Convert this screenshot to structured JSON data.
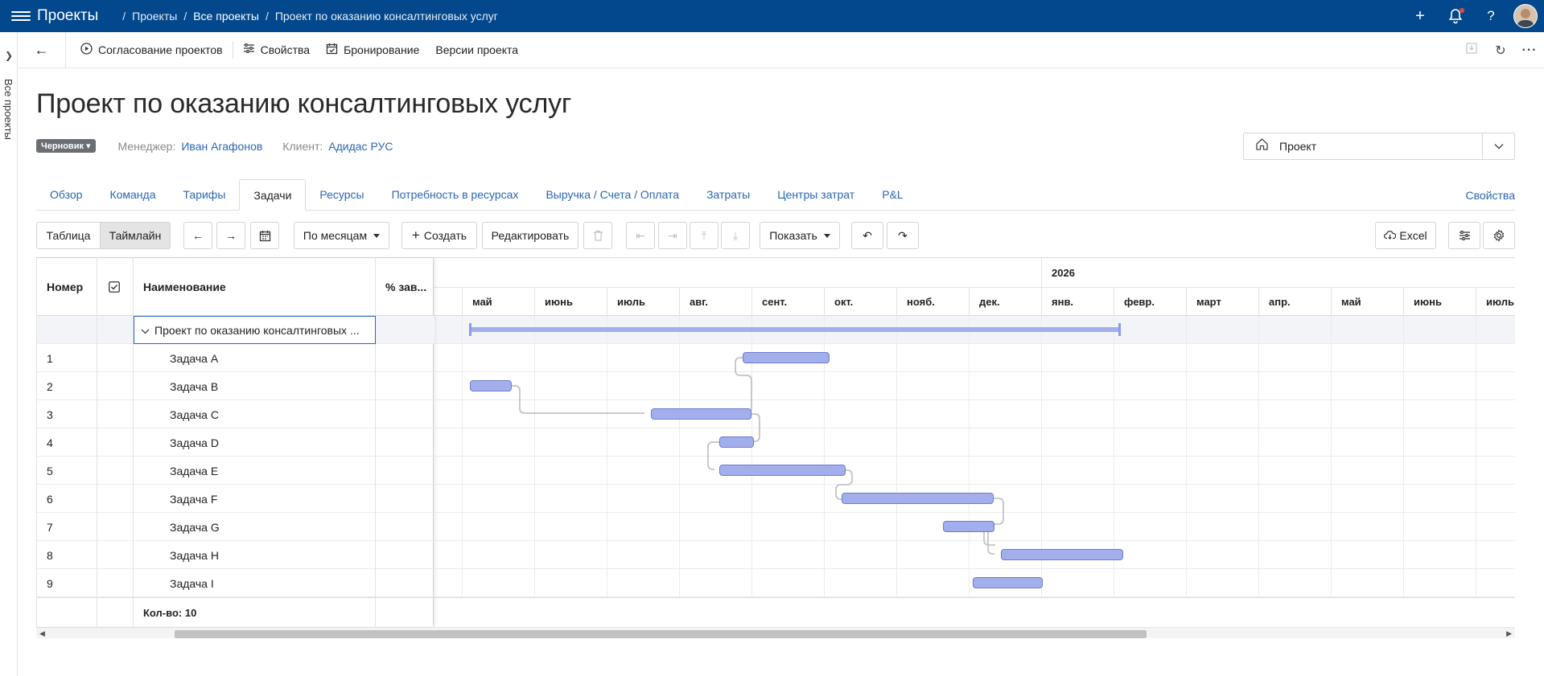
{
  "header": {
    "app_title": "Проекты",
    "breadcrumbs": [
      "Проекты",
      "Все проекты",
      "Проект по оказанию консалтинговых услуг"
    ]
  },
  "rail": {
    "label": "Все проекты"
  },
  "toolbar": {
    "items": [
      {
        "label": "Согласование проектов",
        "icon": "play-circle-icon"
      },
      {
        "label": "Свойства",
        "icon": "sliders-icon"
      },
      {
        "label": "Бронирование",
        "icon": "calendar-check-icon"
      },
      {
        "label": "Версии проекта",
        "icon": ""
      }
    ]
  },
  "project": {
    "title": "Проект по оказанию консалтинговых услуг",
    "status": "Черновик",
    "manager_label": "Менеджер:",
    "manager": "Иван Агафонов",
    "client_label": "Клиент:",
    "client": "Адидас РУС",
    "type_select": "Проект"
  },
  "tabs": {
    "items": [
      "Обзор",
      "Команда",
      "Тарифы",
      "Задачи",
      "Ресурсы",
      "Потребность в ресурсах",
      "Выручка / Счета / Оплата",
      "Затраты",
      "Центры затрат",
      "P&L"
    ],
    "active": "Задачи",
    "properties": "Свойства"
  },
  "grid_toolbar": {
    "view_table": "Таблица",
    "view_timeline": "Таймлайн",
    "scale": "По месяцам",
    "create": "Создать",
    "edit": "Редактировать",
    "show": "Показать",
    "excel": "Excel"
  },
  "table": {
    "columns": [
      "Номер",
      "",
      "Наименование",
      "% зав..."
    ],
    "group_row": "Проект по оказанию консалтинговых ...",
    "rows": [
      {
        "num": "1",
        "name": "Задача A"
      },
      {
        "num": "2",
        "name": "Задача B"
      },
      {
        "num": "3",
        "name": "Задача C"
      },
      {
        "num": "4",
        "name": "Задача D"
      },
      {
        "num": "5",
        "name": "Задача E"
      },
      {
        "num": "6",
        "name": "Задача F"
      },
      {
        "num": "7",
        "name": "Задача G"
      },
      {
        "num": "8",
        "name": "Задача H"
      },
      {
        "num": "9",
        "name": "Задача I"
      }
    ],
    "footer": "Кол-во: 10"
  },
  "timeline": {
    "year_label": "2026",
    "months": [
      "",
      "май",
      "июнь",
      "июль",
      "авг.",
      "сент.",
      "окт.",
      "нояб.",
      "дек.",
      "янв.",
      "февр.",
      "март",
      "апр.",
      "май",
      "июнь",
      "июль"
    ]
  }
}
